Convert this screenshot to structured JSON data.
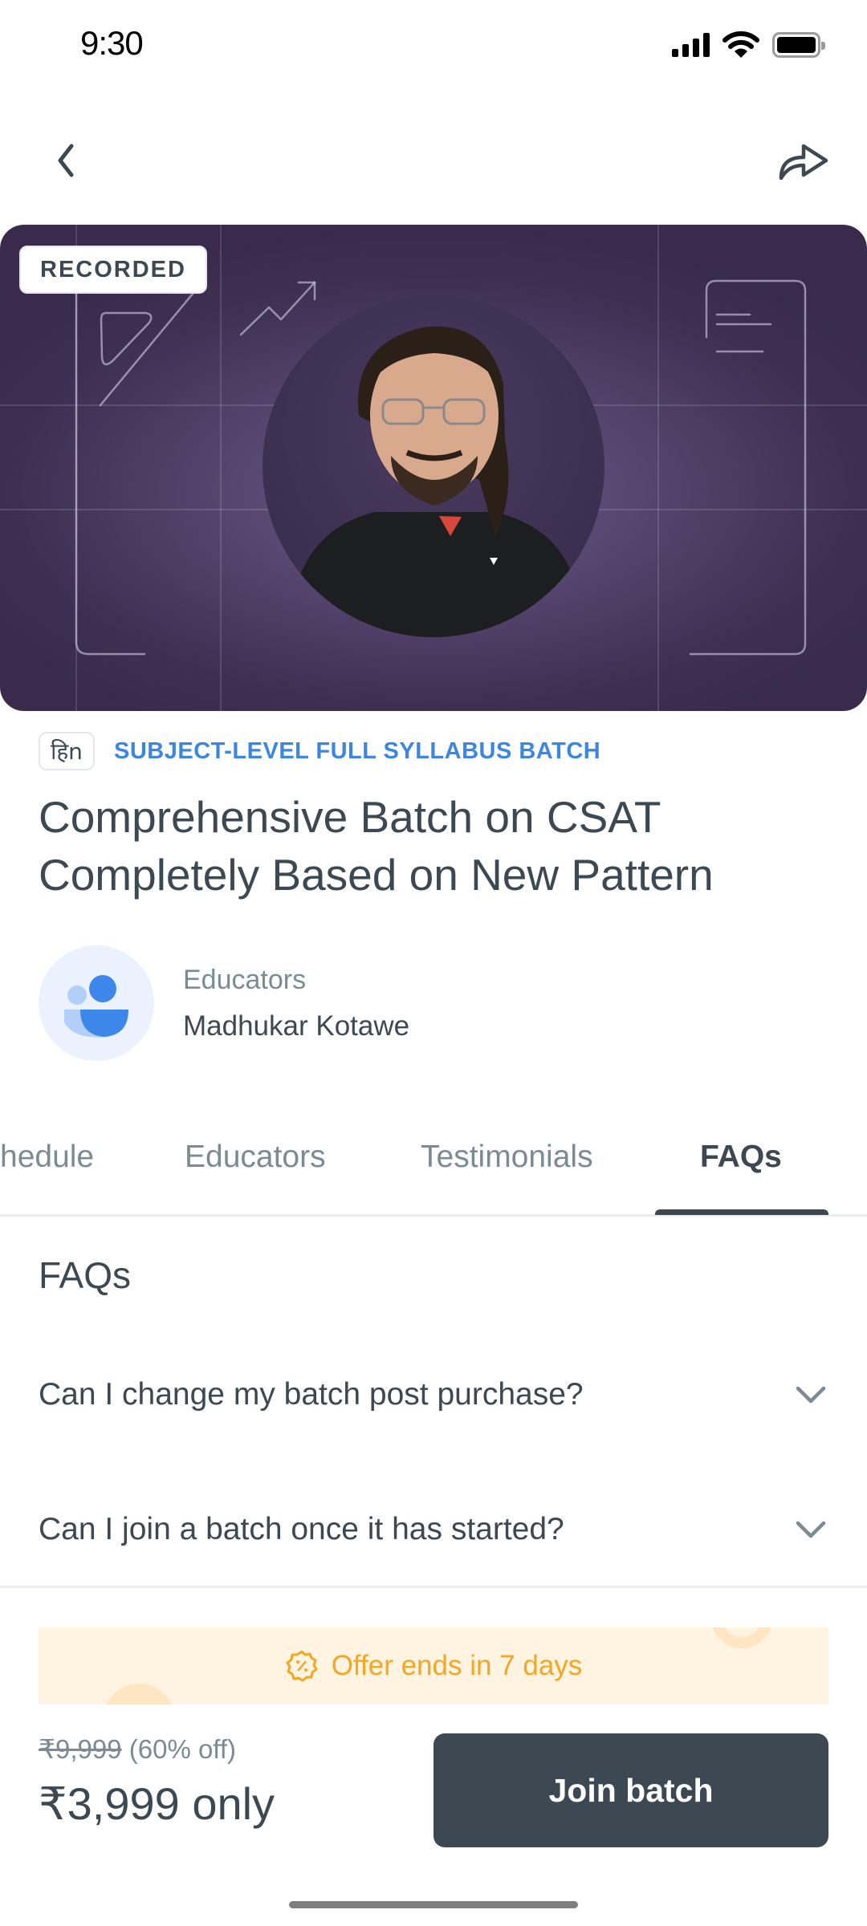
{
  "status_bar": {
    "time": "9:30",
    "icons": [
      "cellular-signal-icon",
      "wifi-icon",
      "battery-icon"
    ]
  },
  "nav": {
    "back_icon": "chevron-left-icon",
    "share_icon": "share-arrow-icon"
  },
  "hero": {
    "badge": "RECORDED",
    "educator_photo": "educator-portrait"
  },
  "course": {
    "language_chip": "हिn",
    "batch_type": "SUBJECT-LEVEL FULL SYLLABUS BATCH",
    "title": "Comprehensive Batch on CSAT Completely Based on New Pattern"
  },
  "educators": {
    "label": "Educators",
    "name": "Madhukar Kotawe"
  },
  "tabs": [
    {
      "label": "hedule",
      "active": false
    },
    {
      "label": "Educators",
      "active": false
    },
    {
      "label": "Testimonials",
      "active": false
    },
    {
      "label": "FAQs",
      "active": true
    }
  ],
  "faqs": {
    "heading": "FAQs",
    "items": [
      {
        "question": "Can I change my batch post purchase?",
        "expanded": false
      },
      {
        "question": "Can I join a batch once it has started?",
        "expanded": false
      }
    ]
  },
  "offer": {
    "text": "Offer ends in 7 days",
    "icon": "discount-badge-icon"
  },
  "pricing": {
    "original_price": "₹9,999",
    "discount": "(60% off)",
    "current_price": "₹3,999 only",
    "cta": "Join batch"
  },
  "colors": {
    "primary_text": "#3c4852",
    "accent_blue": "#3b86e0",
    "offer_orange": "#f5a623",
    "cta_bg": "#3c4852",
    "hero_bg": "#3f2f52"
  }
}
